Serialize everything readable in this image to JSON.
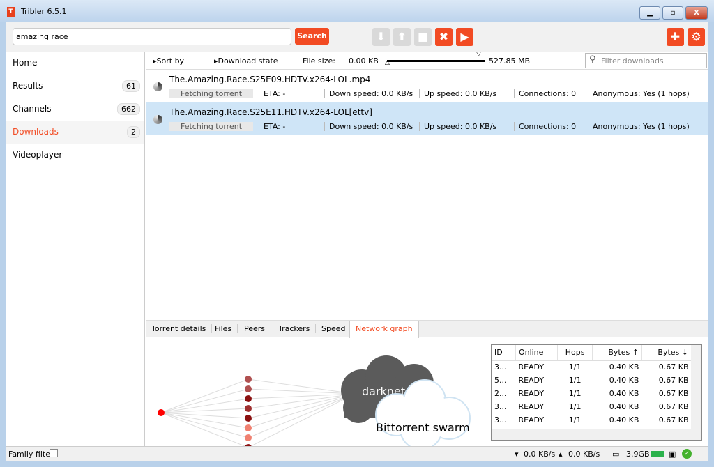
{
  "window": {
    "title": "Tribler 6.5.1",
    "minimize": "▁",
    "maximize": "▫",
    "close": "X"
  },
  "toolbar": {
    "search_value": "amazing race",
    "search_label": "Search"
  },
  "sidebar": {
    "items": [
      {
        "label": "Home",
        "count": null
      },
      {
        "label": "Results",
        "count": "61"
      },
      {
        "label": "Channels",
        "count": "662"
      },
      {
        "label": "Downloads",
        "count": "2"
      },
      {
        "label": "Videoplayer",
        "count": null
      }
    ]
  },
  "list_header": {
    "sort_by": "Sort by",
    "download_state": "Download state",
    "file_size_label": "File size:",
    "min_size": "0.00 KB",
    "max_size": "527.85 MB",
    "filter_placeholder": "Filter downloads"
  },
  "downloads": [
    {
      "name": "The.Amazing.Race.S25E09.HDTV.x264-LOL.mp4",
      "status": "Fetching torrent",
      "eta": "ETA: -",
      "down": "Down speed: 0.0 KB/s",
      "up": "Up speed: 0.0 KB/s",
      "connections": "Connections: 0",
      "anonymous": "Anonymous: Yes (1 hops)"
    },
    {
      "name": "The.Amazing.Race.S25E11.HDTV.x264-LOL[ettv]",
      "status": "Fetching torrent",
      "eta": "ETA: -",
      "down": "Down speed: 0.0 KB/s",
      "up": "Up speed: 0.0 KB/s",
      "connections": "Connections: 0",
      "anonymous": "Anonymous: Yes (1 hops)"
    }
  ],
  "tabs": [
    "Torrent details",
    "Files",
    "Peers",
    "Trackers",
    "Speed",
    "Network graph"
  ],
  "active_tab": "Network graph",
  "graph": {
    "darknet": "darknet",
    "swarm": "Bittorrent swarm"
  },
  "circuits": {
    "columns": [
      "ID",
      "Online",
      "Hops",
      "Bytes ↑",
      "Bytes ↓"
    ],
    "rows": [
      [
        "3...",
        "READY",
        "1/1",
        "0.40 KB",
        "0.67 KB"
      ],
      [
        "5...",
        "READY",
        "1/1",
        "0.40 KB",
        "0.67 KB"
      ],
      [
        "2...",
        "READY",
        "1/1",
        "0.40 KB",
        "0.67 KB"
      ],
      [
        "3...",
        "READY",
        "1/1",
        "0.40 KB",
        "0.67 KB"
      ],
      [
        "3...",
        "READY",
        "1/1",
        "0.40 KB",
        "0.67 KB"
      ]
    ]
  },
  "statusbar": {
    "family_filter": "Family filter",
    "down": "0.0 KB/s",
    "up": "0.0 KB/s",
    "disk": "3.9GB"
  },
  "colors": {
    "accent": "#f24b23",
    "selected_row": "#cfe5f7"
  }
}
